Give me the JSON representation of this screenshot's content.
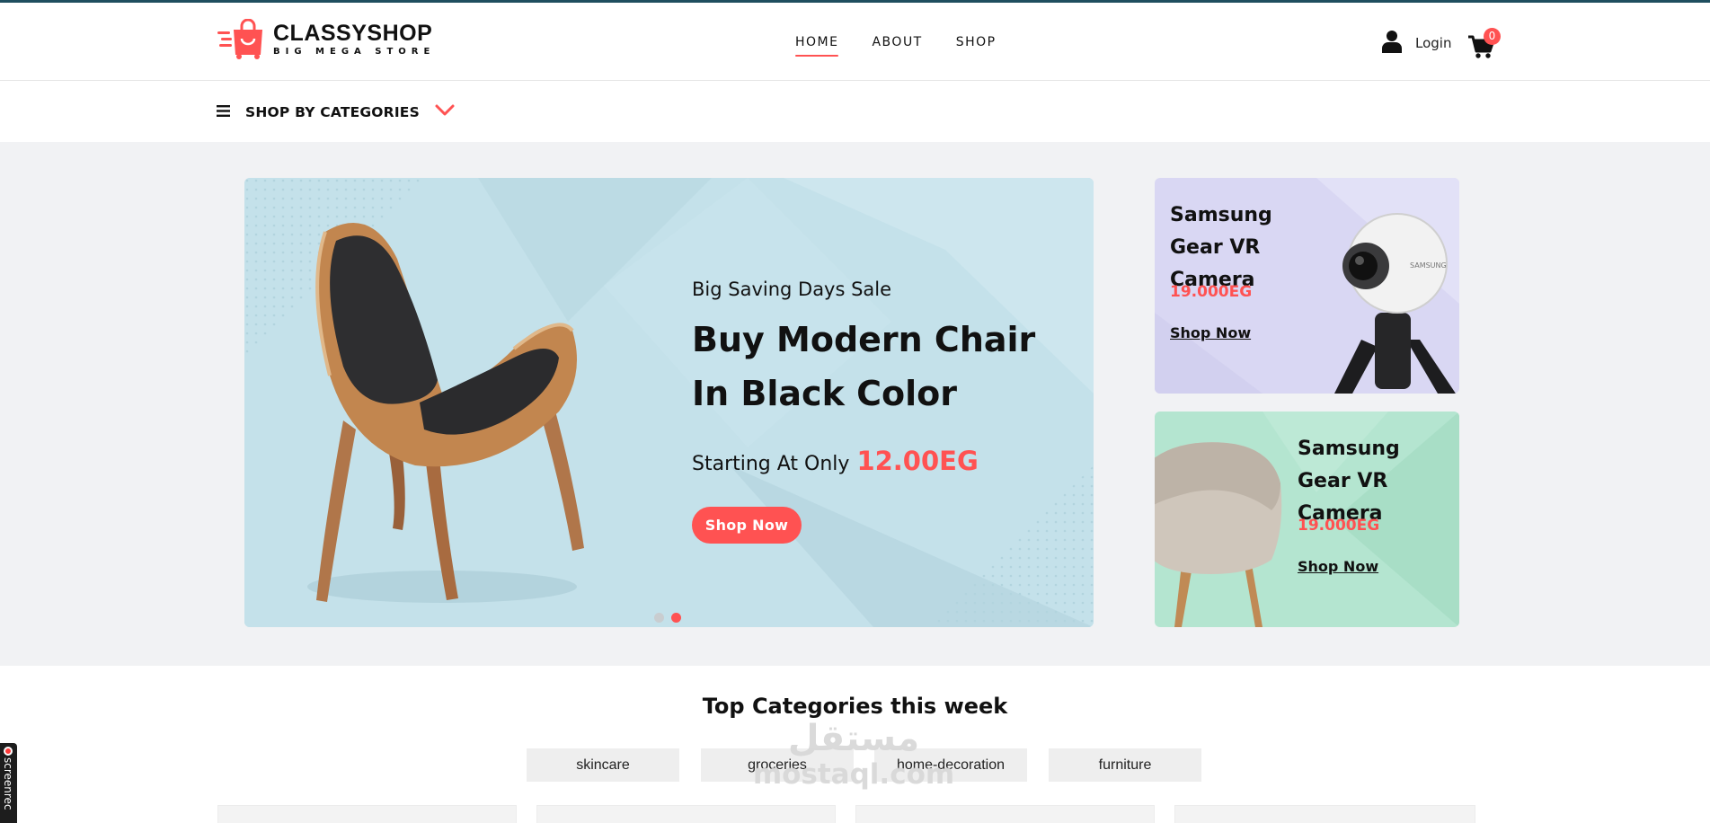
{
  "header": {
    "logo_title": "CLASSYSHOP",
    "logo_subtitle": "BIG MEGA STORE",
    "nav": [
      {
        "label": "HOME",
        "active": true
      },
      {
        "label": "ABOUT",
        "active": false
      },
      {
        "label": "SHOP",
        "active": false
      }
    ],
    "login_label": "Login",
    "cart_count": "0"
  },
  "category_bar": {
    "label": "SHOP BY CATEGORIES"
  },
  "hero": {
    "subtitle": "Big Saving Days Sale",
    "title": "Buy Modern Chair In Black Color",
    "price_prefix": "Starting At Only",
    "price": "12.00EG",
    "button_label": "Shop Now",
    "slide_count": 2,
    "active_slide": 2
  },
  "promos": [
    {
      "title": "Samsung Gear VR Camera",
      "price": "19.000EG",
      "link": "Shop Now"
    },
    {
      "title": "Samsung Gear VR Camera",
      "price": "19.000EG",
      "link": "Shop Now"
    }
  ],
  "top_categories": {
    "title": "Top Categories this week",
    "chips": [
      "skincare",
      "groceries",
      "home-decoration",
      "furniture"
    ]
  },
  "watermark": {
    "arabic": "مستقل",
    "latin": "mostaql.com"
  },
  "recorder_label": "screenrec",
  "colors": {
    "accent": "#ff5252",
    "hero_bg": "#c4e1ea",
    "promo1_bg": "#d9d7f3",
    "promo2_bg": "#b4e5d0",
    "page_band": "#f1f2f4"
  }
}
